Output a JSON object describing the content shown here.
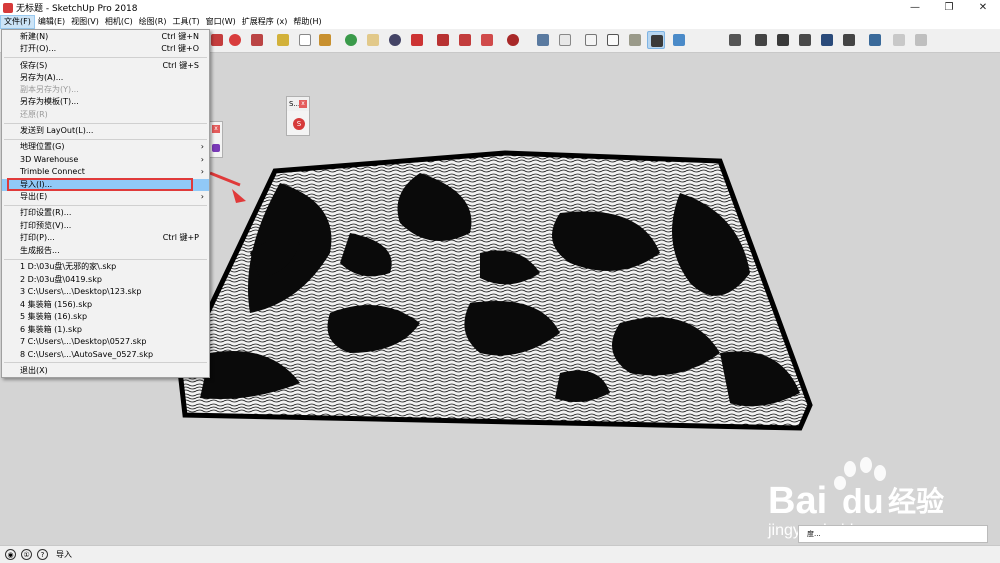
{
  "window": {
    "title": "无标题 - SketchUp Pro 2018",
    "min": "—",
    "max": "❐",
    "close": "✕"
  },
  "menubar": [
    "文件(F)",
    "编辑(E)",
    "视图(V)",
    "相机(C)",
    "绘图(R)",
    "工具(T)",
    "窗口(W)",
    "扩展程序 (x)",
    "帮助(H)"
  ],
  "file_menu": {
    "items": [
      {
        "label": "新建(N)",
        "shortcut": "Ctrl 键+N"
      },
      {
        "label": "打开(O)...",
        "shortcut": "Ctrl 键+O"
      },
      {
        "label": "保存(S)",
        "shortcut": "Ctrl 键+S"
      },
      {
        "label": "另存为(A)..."
      },
      {
        "label": "副本另存为(Y)...",
        "disabled": true
      },
      {
        "label": "另存为模板(T)..."
      },
      {
        "label": "还原(R)",
        "disabled": true
      },
      {
        "label": "发送到 LayOut(L)..."
      },
      {
        "label": "地理位置(G)"
      },
      {
        "label": "3D Warehouse"
      },
      {
        "label": "Trimble Connect"
      },
      {
        "label": "导入(I)..."
      },
      {
        "label": "导出(E)"
      },
      {
        "label": "打印设置(R)..."
      },
      {
        "label": "打印预览(V)..."
      },
      {
        "label": "打印(P)...",
        "shortcut": "Ctrl 键+P"
      },
      {
        "label": "生成报告..."
      },
      {
        "label": "1 D:\\03u盘\\无邪的家\\.skp"
      },
      {
        "label": "2 D:\\03u盘\\0419.skp"
      },
      {
        "label": "3 C:\\Users\\...\\Desktop\\123.skp"
      },
      {
        "label": "4 集装箱 (156).skp"
      },
      {
        "label": "5 集装箱 (16).skp"
      },
      {
        "label": "6 集装箱 (1).skp"
      },
      {
        "label": "7 C:\\Users\\...\\Desktop\\0527.skp"
      },
      {
        "label": "8 C:\\Users\\...\\AutoSave_0527.skp"
      },
      {
        "label": "退出(X)"
      }
    ],
    "submenu_arrow": "›"
  },
  "panels": {
    "small": "S...",
    "close": "x",
    "logo": "S"
  },
  "statusbar": {
    "text": "导入"
  },
  "vcb": {
    "value": "度..."
  },
  "watermark": {
    "brand": "Bai",
    "brand2": "du",
    "cn": "经验",
    "url": "jingyan.baidu.com"
  },
  "colors": {
    "accent": "#e03a3a",
    "highlight": "#91c9f7",
    "toolbar": "#f0f0f0",
    "viewport": "#d4d4d4"
  }
}
